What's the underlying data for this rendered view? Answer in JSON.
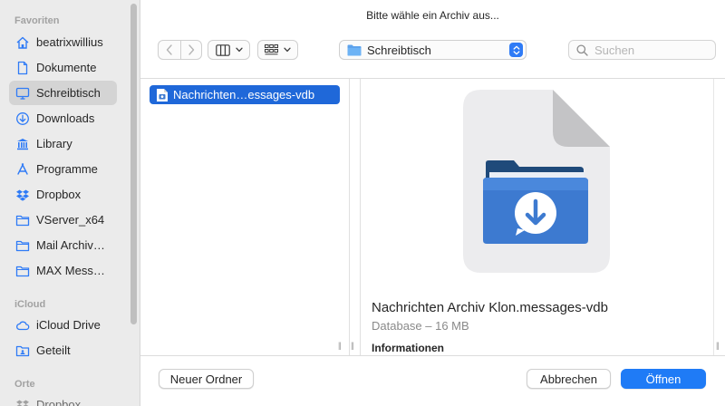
{
  "dialog": {
    "title": "Bitte wähle ein Archiv aus..."
  },
  "sidebar": {
    "sections": {
      "favorites": "Favoriten",
      "icloud": "iCloud",
      "places": "Orte"
    },
    "items": [
      {
        "label": "beatrixwillius",
        "icon": "home-icon"
      },
      {
        "label": "Dokumente",
        "icon": "document-icon"
      },
      {
        "label": "Schreibtisch",
        "icon": "desktop-icon",
        "selected": true
      },
      {
        "label": "Downloads",
        "icon": "download-icon"
      },
      {
        "label": "Library",
        "icon": "library-icon"
      },
      {
        "label": "Programme",
        "icon": "apps-icon"
      },
      {
        "label": "Dropbox",
        "icon": "dropbox-icon"
      },
      {
        "label": "VServer_x64",
        "icon": "folder-icon"
      },
      {
        "label": "Mail Archiv…",
        "icon": "folder-icon"
      },
      {
        "label": "MAX Mess…",
        "icon": "folder-icon"
      },
      {
        "label": "iCloud Drive",
        "icon": "cloud-icon"
      },
      {
        "label": "Geteilt",
        "icon": "shared-folder-icon"
      },
      {
        "label": "Dropbox",
        "icon": "dropbox-icon"
      }
    ]
  },
  "toolbar": {
    "location": "Schreibtisch",
    "search_placeholder": "Suchen"
  },
  "browser": {
    "selected_file": "Nachrichten…essages-vdb",
    "preview": {
      "name": "Nachrichten Archiv Klon.messages-vdb",
      "meta": "Database – 16 MB",
      "info_heading": "Informationen"
    }
  },
  "footer": {
    "new_folder": "Neuer Ordner",
    "cancel": "Abbrechen",
    "open": "Öffnen"
  },
  "colors": {
    "accent": "#1f7bf6",
    "selection": "#1f68d9",
    "sidebar_bg": "#ebebeb",
    "icon_blue": "#2f7bf6"
  }
}
